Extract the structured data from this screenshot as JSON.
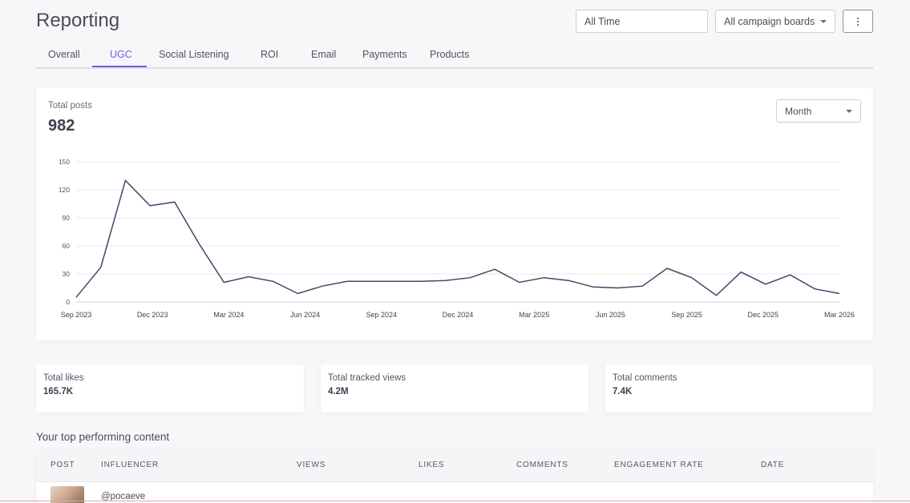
{
  "header": {
    "title": "Reporting",
    "date_filter": "All Time",
    "board_filter": "All campaign boards"
  },
  "tabs": [
    {
      "label": "Overall"
    },
    {
      "label": "UGC",
      "active": true
    },
    {
      "label": "Social Listening"
    },
    {
      "label": "ROI"
    },
    {
      "label": "Email"
    },
    {
      "label": "Payments"
    },
    {
      "label": "Products"
    }
  ],
  "summary": {
    "label": "Total posts",
    "value": "982",
    "period_select": "Month"
  },
  "chart_data": {
    "type": "line",
    "ylim": [
      0,
      150
    ],
    "y_ticks": [
      "0",
      "30",
      "60",
      "90",
      "120",
      "150"
    ],
    "x_tick_labels": [
      "Sep 2023",
      "Dec 2023",
      "Mar 2024",
      "Jun 2024",
      "Sep 2024",
      "Dec 2024",
      "Mar 2025",
      "Jun 2025",
      "Sep 2025",
      "Dec 2025",
      "Mar 2026"
    ],
    "x": [
      "Sep 2023",
      "Oct 2023",
      "Nov 2023",
      "Dec 2023",
      "Jan 2024",
      "Feb 2024",
      "Mar 2024",
      "Apr 2024",
      "May 2024",
      "Jun 2024",
      "Jul 2024",
      "Aug 2024",
      "Sep 2024",
      "Oct 2024",
      "Nov 2024",
      "Dec 2024",
      "Jan 2025",
      "Feb 2025",
      "Mar 2025",
      "Apr 2025",
      "May 2025",
      "Jun 2025",
      "Jul 2025",
      "Aug 2025",
      "Sep 2025",
      "Oct 2025",
      "Nov 2025",
      "Dec 2025",
      "Jan 2026",
      "Feb 2026",
      "Mar 2026"
    ],
    "values": [
      5,
      37,
      130,
      103,
      107,
      62,
      21,
      27,
      22,
      9,
      17,
      22,
      22,
      22,
      22,
      23,
      26,
      35,
      21,
      26,
      23,
      16,
      15,
      17,
      36,
      26,
      7,
      32,
      19,
      29,
      14,
      9
    ],
    "line_color": "#3b4a66",
    "grid": true
  },
  "stats": [
    {
      "label": "Total likes",
      "value": "165.7K"
    },
    {
      "label": "Total tracked views",
      "value": "4.2M"
    },
    {
      "label": "Total comments",
      "value": "7.4K"
    }
  ],
  "top_content": {
    "title": "Your top performing content",
    "columns": [
      "POST",
      "INFLUENCER",
      "VIEWS",
      "LIKES",
      "COMMENTS",
      "ENGAGEMENT RATE",
      "DATE"
    ],
    "rows": [
      {
        "influencer": "@pocaeve"
      }
    ]
  },
  "colors": {
    "accent": "#6c5ce7",
    "line": "#3b4a66"
  }
}
